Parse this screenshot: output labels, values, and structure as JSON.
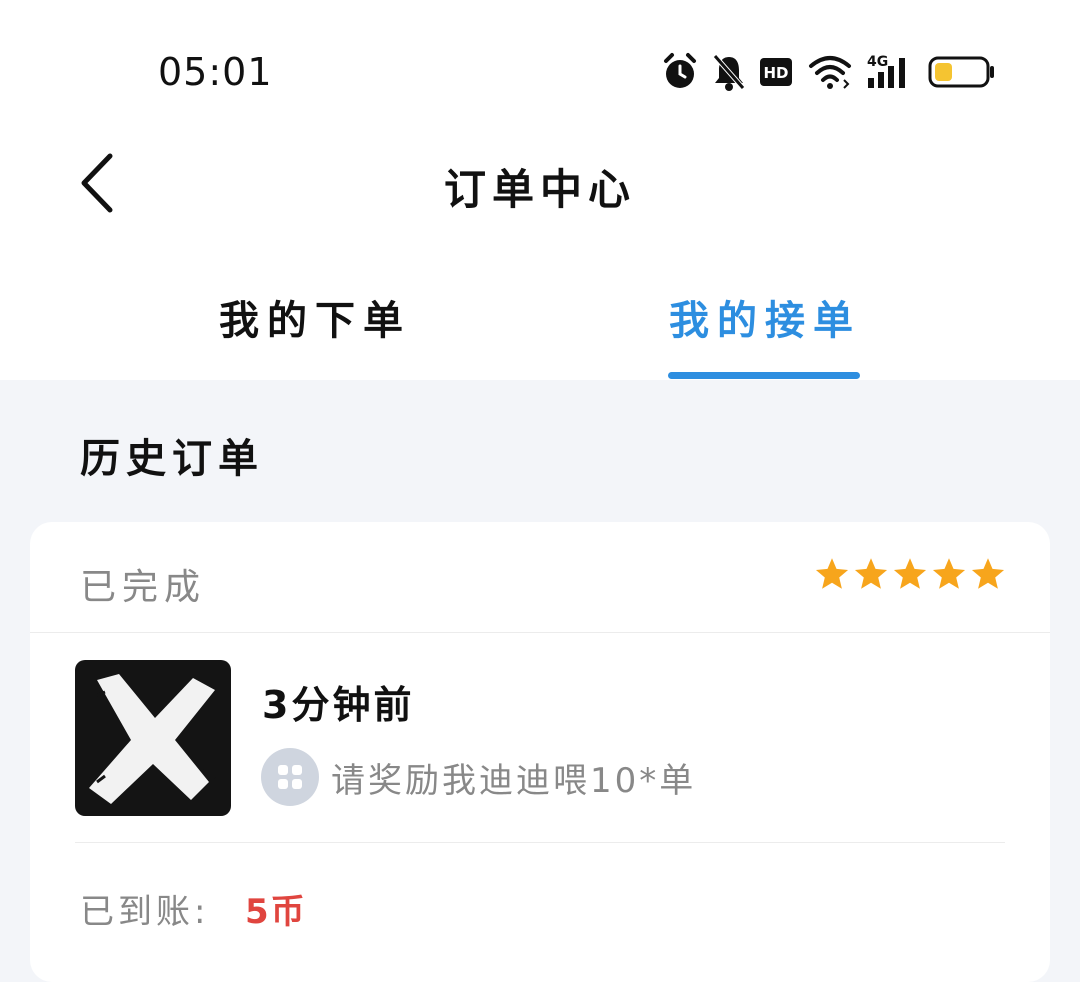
{
  "status_bar": {
    "time": "05:01",
    "icons": [
      "alarm-icon",
      "bell-off-icon",
      "hd-icon",
      "wifi-icon",
      "4g-signal-icon",
      "battery-icon"
    ],
    "battery_color": "#f5c431"
  },
  "header": {
    "title": "订单中心",
    "back_icon": "chevron-left-icon"
  },
  "tabs": [
    {
      "label": "我的下单",
      "active": false
    },
    {
      "label": "我的接单",
      "active": true
    }
  ],
  "accent_color": "#2d8ee0",
  "section": {
    "title": "历史订单"
  },
  "order": {
    "status": "已完成",
    "rating": 5,
    "rating_max": 5,
    "star_color": "#f7a51c",
    "time": "3分钟前",
    "description": "请奖励我迪迪喂10*单",
    "paid_label": "已到账:",
    "paid_amount": "5币",
    "paid_color": "#e0453f"
  }
}
